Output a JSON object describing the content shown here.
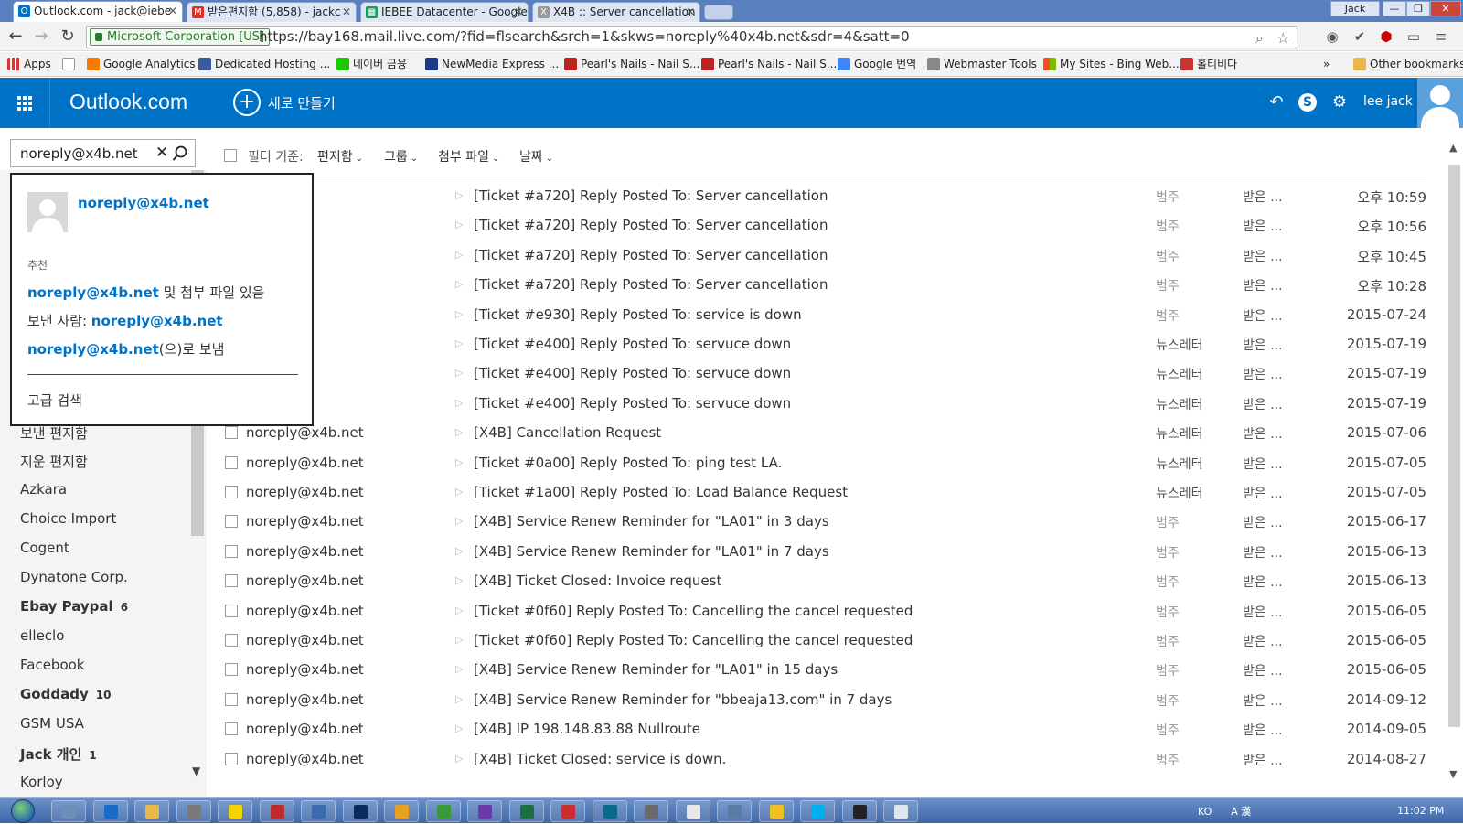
{
  "browser": {
    "tabs": [
      {
        "label": "Outlook.com - jack@iebe",
        "icon": "outlook-icon",
        "active": true
      },
      {
        "label": "받은편지함 (5,858) - jackc",
        "icon": "gmail-icon",
        "active": false
      },
      {
        "label": "IEBEE Datacenter - Google",
        "icon": "sheets-icon",
        "active": false
      },
      {
        "label": "X4B :: Server cancellation",
        "icon": "x4b-icon",
        "active": false
      }
    ],
    "window_user": "Jack",
    "ev_label": "Microsoft Corporation [US]",
    "url": "https://bay168.mail.live.com/?fid=flsearch&srch=1&skws=noreply%40x4b.net&sdr=4&satt=0",
    "bookmarks": [
      {
        "label": "Apps",
        "icon": "apps-icon"
      },
      {
        "label": "",
        "icon": "page-icon"
      },
      {
        "label": "Google Analytics",
        "icon": "analytics-icon"
      },
      {
        "label": "Dedicated Hosting ...",
        "icon": "hosting-icon"
      },
      {
        "label": "네이버 금융",
        "icon": "naver-icon"
      },
      {
        "label": "NewMedia Express ...",
        "icon": "newmedia-icon"
      },
      {
        "label": "Pearl's Nails - Nail S...",
        "icon": "pearls-icon"
      },
      {
        "label": "Pearl's Nails - Nail S...",
        "icon": "pearls-icon"
      },
      {
        "label": "Google 번역",
        "icon": "translate-icon"
      },
      {
        "label": "Webmaster Tools",
        "icon": "webmaster-icon"
      },
      {
        "label": "My Sites - Bing Web...",
        "icon": "bing-icon"
      },
      {
        "label": "홀티비다",
        "icon": "bookmark-icon"
      }
    ],
    "more_bookmarks": "»",
    "other_bookmarks": "Other bookmarks"
  },
  "app": {
    "brand": "Outlook.com",
    "new_label": "새로 만들기",
    "user_name": "lee jack"
  },
  "search": {
    "query": "noreply@x4b.net",
    "suggest": {
      "contact": "noreply@x4b.net",
      "heading": "추천",
      "lines": [
        {
          "pre": "",
          "hl": "noreply@x4b.net",
          "post": " 및 첨부 파일 있음"
        },
        {
          "pre": "보낸 사람: ",
          "hl": "noreply@x4b.net",
          "post": ""
        },
        {
          "pre": "",
          "hl": "noreply@x4b.net",
          "post": "(으)로 보냄"
        }
      ],
      "advanced": "고급 검색"
    }
  },
  "sidebar": {
    "folders": [
      {
        "label": "보낸 편지함",
        "count": "",
        "bold": false
      },
      {
        "label": "지운 편지함",
        "count": "",
        "bold": false
      },
      {
        "label": "Azkara",
        "count": "",
        "bold": false
      },
      {
        "label": "Choice Import",
        "count": "",
        "bold": false
      },
      {
        "label": "Cogent",
        "count": "",
        "bold": false
      },
      {
        "label": "Dynatone Corp.",
        "count": "",
        "bold": false
      },
      {
        "label": "Ebay Paypal",
        "count": "6",
        "bold": true
      },
      {
        "label": "elleclo",
        "count": "",
        "bold": false
      },
      {
        "label": "Facebook",
        "count": "",
        "bold": false
      },
      {
        "label": "Goddady",
        "count": "10",
        "bold": true
      },
      {
        "label": "GSM USA",
        "count": "",
        "bold": false
      },
      {
        "label": "Jack 개인",
        "count": "1",
        "bold": true
      },
      {
        "label": "Korloy",
        "count": "",
        "bold": false
      }
    ]
  },
  "filter": {
    "label": "필터 기준:",
    "options": [
      "편지함",
      "그룹",
      "첨부 파일",
      "날짜"
    ]
  },
  "messages": [
    {
      "from": "4b.net",
      "subject": "[Ticket #a720] Reply Posted To: Server cancellation",
      "category": "범주",
      "folder": "받은 ...",
      "date": "오후 10:59"
    },
    {
      "from": "4b.net",
      "subject": "[Ticket #a720] Reply Posted To: Server cancellation",
      "category": "범주",
      "folder": "받은 ...",
      "date": "오후 10:56"
    },
    {
      "from": "4b.net",
      "subject": "[Ticket #a720] Reply Posted To: Server cancellation",
      "category": "범주",
      "folder": "받은 ...",
      "date": "오후 10:45"
    },
    {
      "from": "4b.net",
      "subject": "[Ticket #a720] Reply Posted To: Server cancellation",
      "category": "범주",
      "folder": "받은 ...",
      "date": "오후 10:28"
    },
    {
      "from": "4b.net",
      "subject": "[Ticket #e930] Reply Posted To: service is down",
      "category": "범주",
      "folder": "받은 ...",
      "date": "2015-07-24"
    },
    {
      "from": "4b.net",
      "subject": "[Ticket #e400] Reply Posted To: servuce down",
      "category": "뉴스레터",
      "folder": "받은 ...",
      "date": "2015-07-19"
    },
    {
      "from": "4b.net",
      "subject": "[Ticket #e400] Reply Posted To: servuce down",
      "category": "뉴스레터",
      "folder": "받은 ...",
      "date": "2015-07-19"
    },
    {
      "from": "4b.net",
      "subject": "[Ticket #e400] Reply Posted To: servuce down",
      "category": "뉴스레터",
      "folder": "받은 ...",
      "date": "2015-07-19"
    },
    {
      "from": "noreply@x4b.net",
      "subject": "[X4B] Cancellation Request",
      "category": "뉴스레터",
      "folder": "받은 ...",
      "date": "2015-07-06"
    },
    {
      "from": "noreply@x4b.net",
      "subject": "[Ticket #0a00] Reply Posted To: ping test LA.",
      "category": "뉴스레터",
      "folder": "받은 ...",
      "date": "2015-07-05"
    },
    {
      "from": "noreply@x4b.net",
      "subject": "[Ticket #1a00] Reply Posted To: Load Balance Request",
      "category": "뉴스레터",
      "folder": "받은 ...",
      "date": "2015-07-05"
    },
    {
      "from": "noreply@x4b.net",
      "subject": "[X4B] Service Renew Reminder for \"LA01\" in 3 days",
      "category": "범주",
      "folder": "받은 ...",
      "date": "2015-06-17"
    },
    {
      "from": "noreply@x4b.net",
      "subject": "[X4B] Service Renew Reminder for \"LA01\" in 7 days",
      "category": "범주",
      "folder": "받은 ...",
      "date": "2015-06-13"
    },
    {
      "from": "noreply@x4b.net",
      "subject": "[X4B] Ticket Closed: Invoice request",
      "category": "범주",
      "folder": "받은 ...",
      "date": "2015-06-13"
    },
    {
      "from": "noreply@x4b.net",
      "subject": "[Ticket #0f60] Reply Posted To: Cancelling the cancel requested",
      "category": "범주",
      "folder": "받은 ...",
      "date": "2015-06-05"
    },
    {
      "from": "noreply@x4b.net",
      "subject": "[Ticket #0f60] Reply Posted To: Cancelling the cancel requested",
      "category": "범주",
      "folder": "받은 ...",
      "date": "2015-06-05"
    },
    {
      "from": "noreply@x4b.net",
      "subject": "[X4B] Service Renew Reminder for \"LA01\" in 15 days",
      "category": "범주",
      "folder": "받은 ...",
      "date": "2015-06-05"
    },
    {
      "from": "noreply@x4b.net",
      "subject": "[X4B] Service Renew Reminder for \"bbeaja13.com\" in 7 days",
      "category": "범주",
      "folder": "받은 ...",
      "date": "2014-09-12"
    },
    {
      "from": "noreply@x4b.net",
      "subject": "[X4B] IP 198.148.83.88 Nullroute",
      "category": "범주",
      "folder": "받은 ...",
      "date": "2014-09-05"
    },
    {
      "from": "noreply@x4b.net",
      "subject": "[X4B] Ticket Closed: service is down.",
      "category": "범주",
      "folder": "받은 ...",
      "date": "2014-08-27"
    }
  ],
  "taskbar": {
    "apps": [
      "explorer-icon",
      "ie-icon",
      "folder-icon",
      "network-icon",
      "kakaotalk-icon",
      "filezilla-icon",
      "remote-icon",
      "photoshop-icon",
      "paint-icon",
      "excel-green-icon",
      "vs-icon",
      "excel-icon",
      "adobe-icon",
      "dreamweaver-icon",
      "calc-icon",
      "chrome-icon",
      "window-icon",
      "norton-icon",
      "skype-icon",
      "cmd-icon",
      "notepad-icon"
    ],
    "lang": "KO",
    "ime": "A 漢",
    "clock": "11:02 PM"
  },
  "colors": {
    "brand": "#0072c6",
    "link": "#0072c6"
  }
}
